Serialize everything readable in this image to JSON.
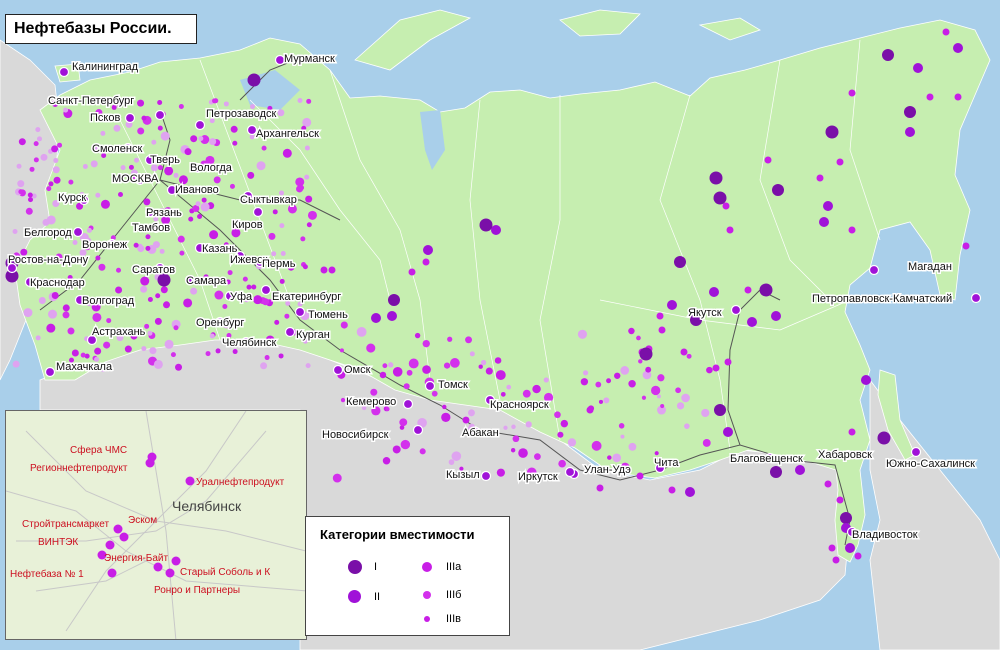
{
  "title": "Нефтебазы России.",
  "colors": {
    "sea": "#a9cfea",
    "land": "#c6eeb0",
    "foreign": "#d9d9d9",
    "cat_I": "#7a0fa8",
    "cat_II": "#a012d8",
    "cat_IIIa": "#c81ee6",
    "cat_IIIb": "#d330ec",
    "cat_IIIc": "#dfa3f0",
    "inset_label": "#cc1020"
  },
  "cities": [
    {
      "name": "Мурманск"
    },
    {
      "name": "Калининград"
    },
    {
      "name": "Санкт-Петербург"
    },
    {
      "name": "Петрозаводск"
    },
    {
      "name": "Архангельск"
    },
    {
      "name": "Псков"
    },
    {
      "name": "Смоленск"
    },
    {
      "name": "Тверь"
    },
    {
      "name": "Вологда"
    },
    {
      "name": "МОСКВА"
    },
    {
      "name": "Иваново"
    },
    {
      "name": "Курск"
    },
    {
      "name": "Рязань"
    },
    {
      "name": "Сыктывкар"
    },
    {
      "name": "Белгород"
    },
    {
      "name": "Тамбов"
    },
    {
      "name": "Киров"
    },
    {
      "name": "Воронеж"
    },
    {
      "name": "Казань"
    },
    {
      "name": "Ростов-на-Дону"
    },
    {
      "name": "Саратов"
    },
    {
      "name": "Ижевск"
    },
    {
      "name": "Пермь"
    },
    {
      "name": "Краснодар"
    },
    {
      "name": "Самара"
    },
    {
      "name": "Екатеринбург"
    },
    {
      "name": "Волгоград"
    },
    {
      "name": "Уфа"
    },
    {
      "name": "Тюмень"
    },
    {
      "name": "Оренбург"
    },
    {
      "name": "Астрахань"
    },
    {
      "name": "Челябинск"
    },
    {
      "name": "Курган"
    },
    {
      "name": "Махачкала"
    },
    {
      "name": "Омск"
    },
    {
      "name": "Томск"
    },
    {
      "name": "Кемерово"
    },
    {
      "name": "Красноярск"
    },
    {
      "name": "Новосибирск"
    },
    {
      "name": "Абакан"
    },
    {
      "name": "Кызыл"
    },
    {
      "name": "Иркутск"
    },
    {
      "name": "Улан-Удэ"
    },
    {
      "name": "Чита"
    },
    {
      "name": "Благовещенск"
    },
    {
      "name": "Хабаровск"
    },
    {
      "name": "Якутск"
    },
    {
      "name": "Магадан"
    },
    {
      "name": "Петропавловск-Камчатский"
    },
    {
      "name": "Южно-Сахалинск"
    },
    {
      "name": "Владивосток"
    }
  ],
  "inset": {
    "city": "Челябинск",
    "companies": [
      {
        "name": "Сфера ЧМС"
      },
      {
        "name": "Регионнефтепродукт"
      },
      {
        "name": "Уралнефтепродукт"
      },
      {
        "name": "Стройтрансмаркет"
      },
      {
        "name": "Эском"
      },
      {
        "name": "ВИНТЭК"
      },
      {
        "name": "Энергия-Байт"
      },
      {
        "name": "Нефтебаза № 1"
      },
      {
        "name": "Старый Соболь и К"
      },
      {
        "name": "Ронро и Партнеры"
      }
    ]
  },
  "legend": {
    "title": "Категории вместимости",
    "items": [
      {
        "label": "I",
        "color": "#7a0fa8"
      },
      {
        "label": "II",
        "color": "#a012d8"
      },
      {
        "label": "IIIа",
        "color": "#c81ee6"
      },
      {
        "label": "IIIб",
        "color": "#d330ec"
      },
      {
        "label": "IIIв",
        "color": "#c81ee6"
      }
    ]
  }
}
